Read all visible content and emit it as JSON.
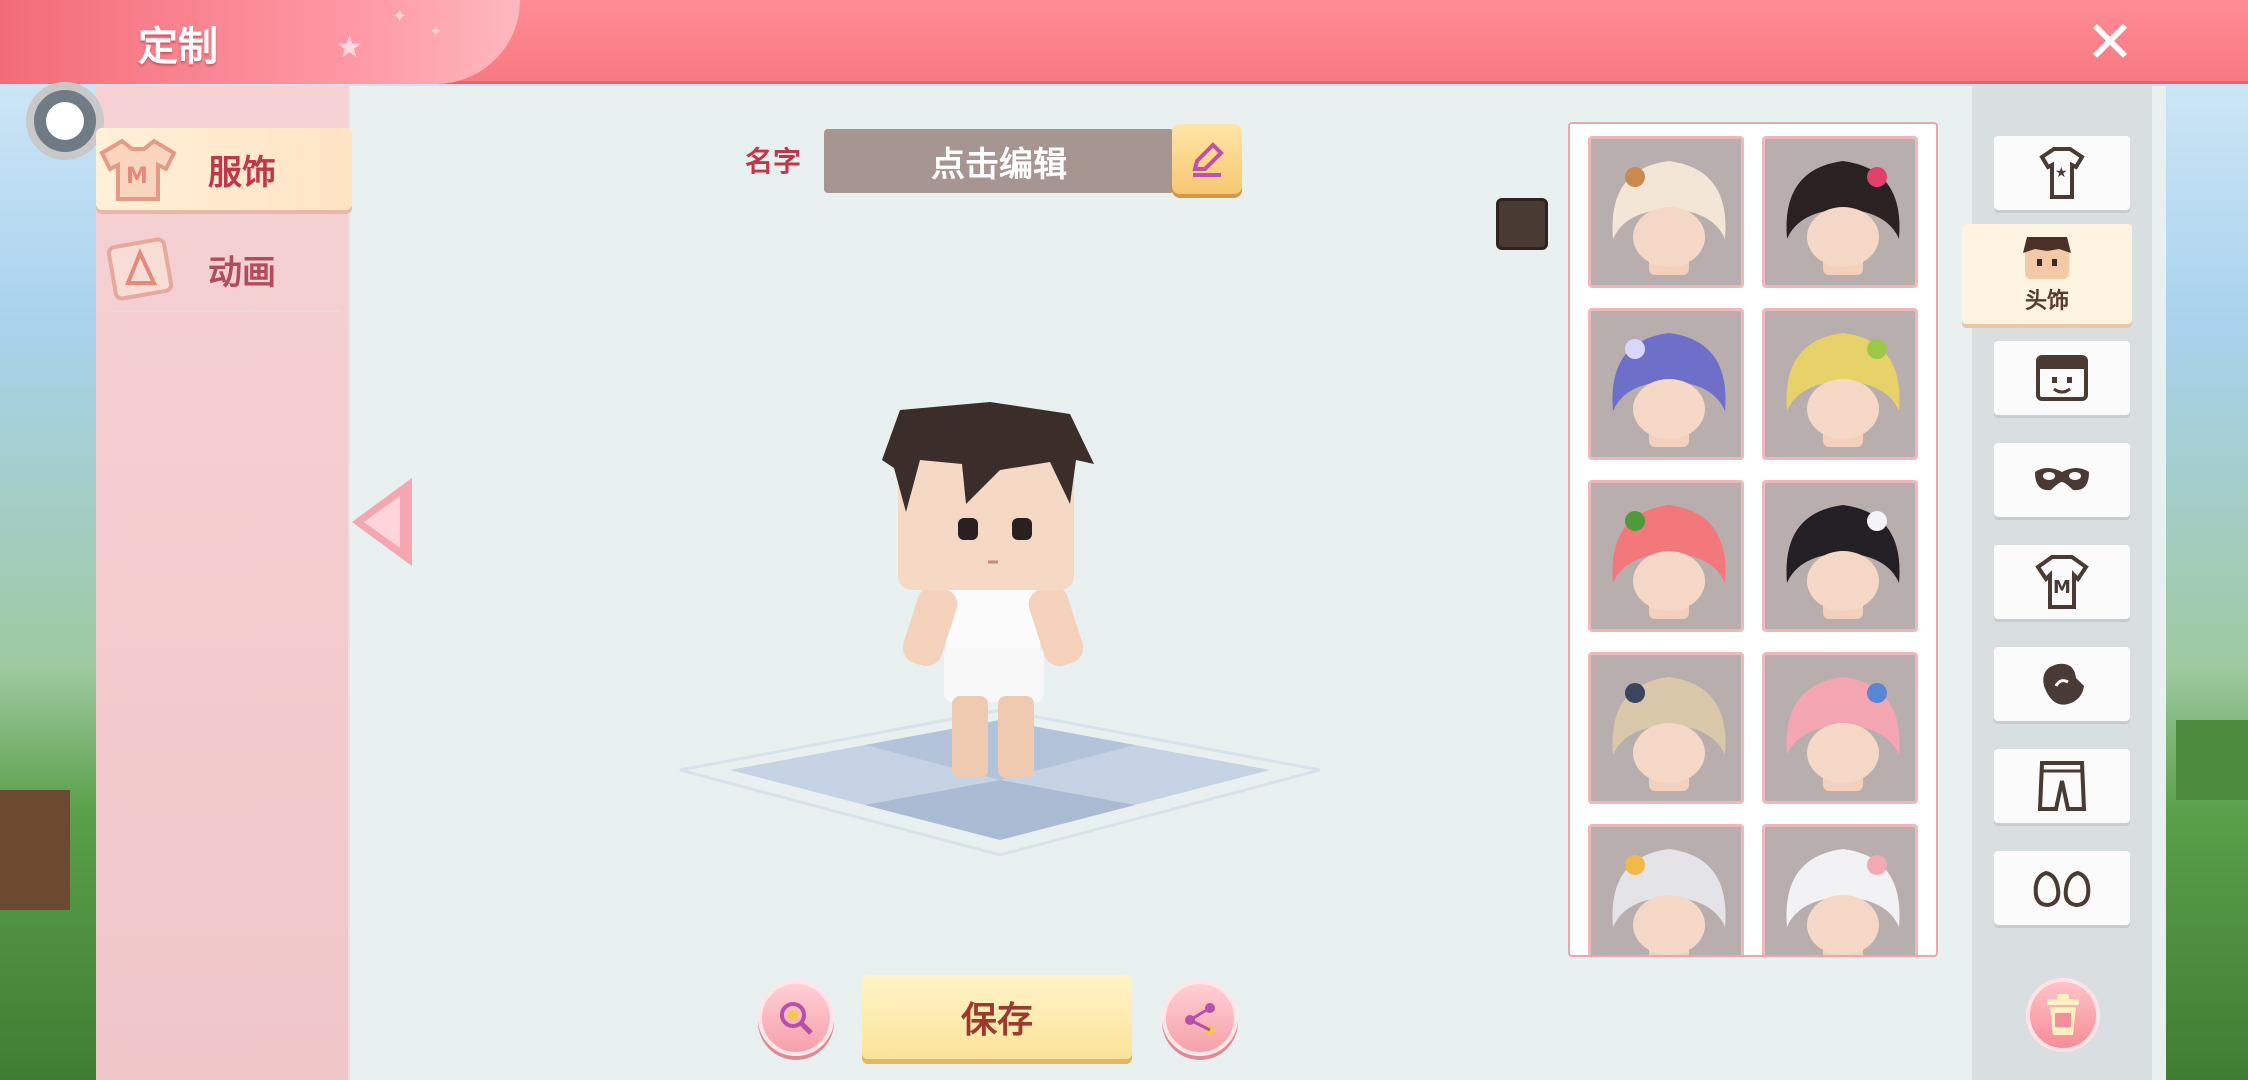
{
  "header": {
    "title": "定制",
    "close_icon": "close-icon"
  },
  "left_tabs": [
    {
      "label": "服饰",
      "icon": "clothing-icon",
      "active": true
    },
    {
      "label": "动画",
      "icon": "animation-icon",
      "active": false
    }
  ],
  "name_row": {
    "label": "名字",
    "field_text": "点击编辑",
    "edit_icon": "pencil-icon"
  },
  "color_swatch": "#4a3a34",
  "items": [
    {
      "name": "cat-hood-hair",
      "hair": "#f3e6d6",
      "accent": "#c88a4e"
    },
    {
      "name": "black-flower-bun-hair",
      "hair": "#2a2222",
      "accent": "#e0406a"
    },
    {
      "name": "purple-helmet-hair",
      "hair": "#6e6fc8",
      "accent": "#d8d8ff"
    },
    {
      "name": "blonde-sprout-hair",
      "hair": "#e7d26a",
      "accent": "#9ec84a"
    },
    {
      "name": "peach-leaf-hair",
      "hair": "#f2787c",
      "accent": "#4f9a3a"
    },
    {
      "name": "bunny-ears-black-hair",
      "hair": "#222025",
      "accent": "#f4f4f8"
    },
    {
      "name": "beige-cap-hair",
      "hair": "#d9c8aa",
      "accent": "#3b4560"
    },
    {
      "name": "pink-wavy-flower-hair",
      "hair": "#f4a6b2",
      "accent": "#5a86d8"
    },
    {
      "name": "white-ponytail-crown-hair",
      "hair": "#e4e4e8",
      "accent": "#f2b84a"
    },
    {
      "name": "white-cat-ears-hair",
      "hair": "#f2f2f4",
      "accent": "#f2a9b4"
    }
  ],
  "categories": [
    {
      "name": "outfit",
      "icon": "outfit-icon",
      "label": "",
      "active": false
    },
    {
      "name": "headwear",
      "icon": "face-head-icon",
      "label": "头饰",
      "active": true
    },
    {
      "name": "face",
      "icon": "face-icon",
      "label": "",
      "active": false
    },
    {
      "name": "mask",
      "icon": "mask-icon",
      "label": "",
      "active": false
    },
    {
      "name": "shirt",
      "icon": "shirt-icon",
      "label": "",
      "active": false
    },
    {
      "name": "gloves",
      "icon": "glove-icon",
      "label": "",
      "active": false
    },
    {
      "name": "pants",
      "icon": "pants-icon",
      "label": "",
      "active": false
    },
    {
      "name": "shoes",
      "icon": "shoes-icon",
      "label": "",
      "active": false
    }
  ],
  "bottom": {
    "save_label": "保存",
    "zoom_icon": "magnifier-icon",
    "share_icon": "share-icon"
  },
  "trash_icon": "trash-icon"
}
